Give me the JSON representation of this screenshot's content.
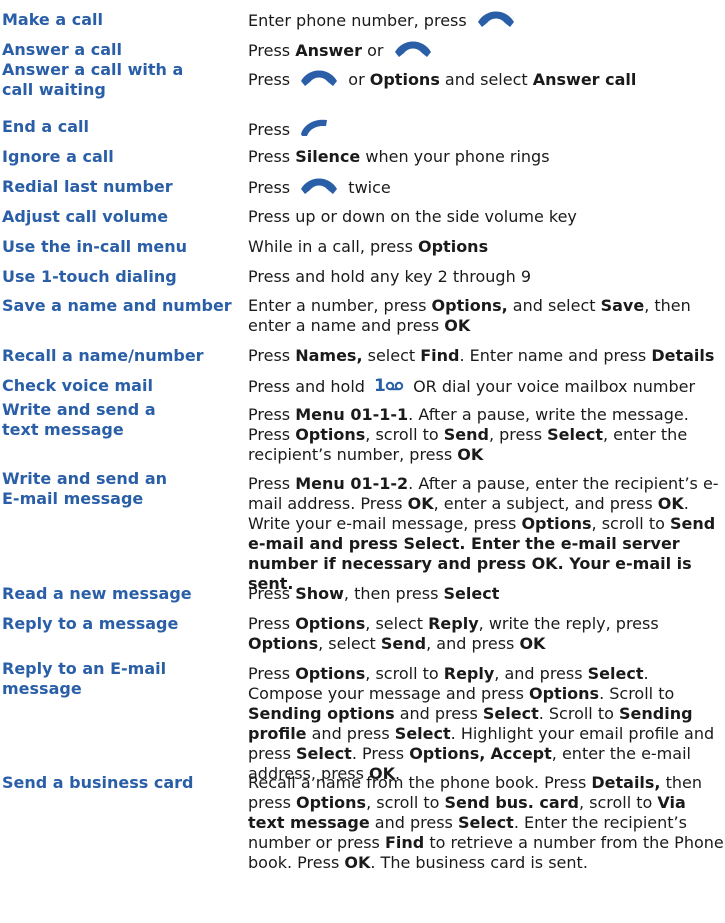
{
  "rows": [
    {
      "task": "Make a call",
      "segments": [
        {
          "t": "Enter phone number, press "
        },
        {
          "icon": "call-key-icon"
        }
      ]
    },
    {
      "task": "Answer a call",
      "segments": [
        {
          "t": "Press "
        },
        {
          "t": "Answer",
          "b": true
        },
        {
          "t": " or "
        },
        {
          "icon": "call-key-icon"
        }
      ]
    },
    {
      "task": "Answer a call with a call waiting",
      "segments": [
        {
          "t": "Press "
        },
        {
          "icon": "call-key-icon"
        },
        {
          "t": " or "
        },
        {
          "t": "Options",
          "b": true
        },
        {
          "t": " and select "
        },
        {
          "t": "Answer call",
          "b": true
        }
      ]
    },
    {
      "task": "End a call",
      "segments": [
        {
          "t": "Press "
        },
        {
          "icon": "end-key-icon"
        }
      ]
    },
    {
      "task": "Ignore a call",
      "segments": [
        {
          "t": "Press "
        },
        {
          "t": "Silence",
          "b": true
        },
        {
          "t": " when your phone rings"
        }
      ]
    },
    {
      "task": "Redial last number",
      "segments": [
        {
          "t": "Press "
        },
        {
          "icon": "call-key-icon"
        },
        {
          "t": " twice"
        }
      ]
    },
    {
      "task": "Adjust call volume",
      "segments": [
        {
          "t": "Press up or down on the side volume key"
        }
      ]
    },
    {
      "task": "Use the in-call menu",
      "segments": [
        {
          "t": "While in a call, press "
        },
        {
          "t": "Options",
          "b": true
        }
      ]
    },
    {
      "task": "Use 1-touch dialing",
      "segments": [
        {
          "t": "Press and hold any key 2 through 9"
        }
      ]
    },
    {
      "task": "Save a name and number",
      "segments": [
        {
          "t": "Enter a number, press "
        },
        {
          "t": "Options,",
          "b": true
        },
        {
          "t": " and select "
        },
        {
          "t": "Save",
          "b": true
        },
        {
          "t": ", then enter a name and press "
        },
        {
          "t": "OK",
          "b": true
        }
      ]
    },
    {
      "task": "Recall a name/number",
      "segments": [
        {
          "t": "Press "
        },
        {
          "t": "Names,",
          "b": true
        },
        {
          "t": " select "
        },
        {
          "t": "Find",
          "b": true
        },
        {
          "t": ". Enter name and press "
        },
        {
          "t": "Details",
          "b": true
        }
      ]
    },
    {
      "task": "Check voice mail",
      "segments": [
        {
          "t": "Press and hold "
        },
        {
          "icon": "voicemail-key-icon"
        },
        {
          "t": " OR dial your voice mailbox number"
        }
      ]
    },
    {
      "task": "Write and send a text message",
      "segments": [
        {
          "t": "Press "
        },
        {
          "t": "Menu 01-1-1",
          "b": true
        },
        {
          "t": ". After a pause, write the message. Press "
        },
        {
          "t": "Options",
          "b": true
        },
        {
          "t": ", scroll to "
        },
        {
          "t": "Send",
          "b": true
        },
        {
          "t": ", press "
        },
        {
          "t": "Select",
          "b": true
        },
        {
          "t": ", enter the recipient’s number, press "
        },
        {
          "t": "OK",
          "b": true
        }
      ]
    },
    {
      "task": "Write and send an E-mail message",
      "segments": [
        {
          "t": "Press "
        },
        {
          "t": "Menu 01-1-2",
          "b": true
        },
        {
          "t": ". After a pause, enter the recipient’s e-mail address. Press "
        },
        {
          "t": "OK",
          "b": true
        },
        {
          "t": ", enter a subject, and press "
        },
        {
          "t": "OK",
          "b": true
        },
        {
          "t": ". Write your e-mail message, press "
        },
        {
          "t": "Options",
          "b": true
        },
        {
          "t": ", scroll to "
        },
        {
          "t": "Send e-mail and press Select. Enter the e-mail server number if necessary and press OK. Your e-mail is sent.",
          "b": true
        }
      ]
    },
    {
      "task": "Read a new message",
      "segments": [
        {
          "t": "Press "
        },
        {
          "t": "Show",
          "b": true
        },
        {
          "t": ", then press "
        },
        {
          "t": "Select",
          "b": true
        }
      ]
    },
    {
      "task": "Reply to a message",
      "segments": [
        {
          "t": "Press "
        },
        {
          "t": "Options",
          "b": true
        },
        {
          "t": ", select "
        },
        {
          "t": "Reply",
          "b": true
        },
        {
          "t": ", write the reply, press "
        },
        {
          "t": "Options",
          "b": true
        },
        {
          "t": ", select "
        },
        {
          "t": "Send",
          "b": true
        },
        {
          "t": ", and press "
        },
        {
          "t": "OK",
          "b": true
        }
      ]
    },
    {
      "task": "Reply to an E-mail message",
      "segments": [
        {
          "t": "Press "
        },
        {
          "t": "Options",
          "b": true
        },
        {
          "t": ", scroll to "
        },
        {
          "t": "Reply",
          "b": true
        },
        {
          "t": ", and press "
        },
        {
          "t": "Select",
          "b": true
        },
        {
          "t": ". Compose your message and press "
        },
        {
          "t": "Options",
          "b": true
        },
        {
          "t": ". Scroll to "
        },
        {
          "t": "Sending options",
          "b": true
        },
        {
          "t": " and press "
        },
        {
          "t": "Select",
          "b": true
        },
        {
          "t": ". Scroll to "
        },
        {
          "t": "Sending profile",
          "b": true
        },
        {
          "t": " and press "
        },
        {
          "t": "Select",
          "b": true
        },
        {
          "t": ". Highlight your email profile and press "
        },
        {
          "t": "Select",
          "b": true
        },
        {
          "t": ". Press "
        },
        {
          "t": "Options,",
          "b": true
        },
        {
          "t": " "
        },
        {
          "t": "Accept",
          "b": true
        },
        {
          "t": ", enter the e-mail address, press "
        },
        {
          "t": "OK",
          "b": true
        },
        {
          "t": "."
        }
      ]
    },
    {
      "task": "Send a business card",
      "segments": [
        {
          "t": "Recall a name from the phone book. Press "
        },
        {
          "t": "Details,",
          "b": true
        },
        {
          "t": " then press "
        },
        {
          "t": "Options",
          "b": true
        },
        {
          "t": ", scroll to "
        },
        {
          "t": "Send bus. card",
          "b": true
        },
        {
          "t": ", scroll to "
        },
        {
          "t": "Via text message",
          "b": true
        },
        {
          "t": " and press "
        },
        {
          "t": "Select",
          "b": true
        },
        {
          "t": ". Enter the recipient’s number or press "
        },
        {
          "t": "Find",
          "b": true
        },
        {
          "t": " to retrieve a number from the Phone book. Press "
        },
        {
          "t": "OK",
          "b": true
        },
        {
          "t": ". The business card is sent."
        }
      ]
    }
  ]
}
